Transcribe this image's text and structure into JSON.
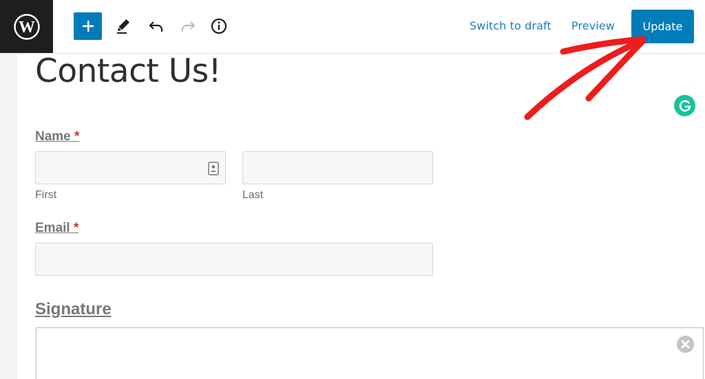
{
  "toolbar": {
    "switch_to_draft": "Switch to draft",
    "preview": "Preview",
    "update": "Update"
  },
  "page": {
    "title": "Contact Us!"
  },
  "form": {
    "name": {
      "label": "Name",
      "required_mark": "*",
      "first_sublabel": "First",
      "last_sublabel": "Last"
    },
    "email": {
      "label": "Email",
      "required_mark": "*"
    },
    "signature": {
      "label": "Signature"
    }
  },
  "icons": {
    "logo": "wordpress-icon",
    "add": "plus-icon",
    "tools": "pencil-icon",
    "undo": "undo-icon",
    "redo": "redo-icon",
    "info": "info-icon",
    "grammarly": "grammarly-icon",
    "contact_card": "contact-card-icon",
    "clear": "close-circle-icon"
  },
  "colors": {
    "accent": "#007cba",
    "link": "#1b7fc1",
    "annotation_arrow": "#ee1c1c",
    "grammarly": "#15c39a"
  }
}
